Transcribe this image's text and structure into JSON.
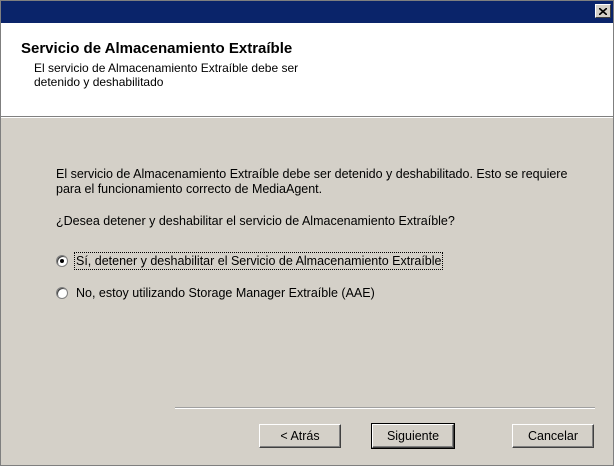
{
  "titlebar": {
    "close_icon": "close-icon"
  },
  "header": {
    "title": "Servicio de Almacenamiento Extraíble",
    "subtitle": "El servicio de Almacenamiento Extraíble debe ser detenido y deshabilitado"
  },
  "body": {
    "description": "El servicio de Almacenamiento Extraíble debe ser detenido y deshabilitado. Esto se requiere para el funcionamiento correcto de MediaAgent.",
    "question": "¿Desea detener y deshabilitar el servicio de Almacenamiento Extraíble?",
    "options": [
      {
        "label": "Sí, detener y deshabilitar el Servicio de Almacenamiento Extraíble",
        "selected": true
      },
      {
        "label": "No, estoy utilizando Storage Manager Extraíble (AAE)",
        "selected": false
      }
    ]
  },
  "buttons": {
    "back_label": "< Atrás",
    "next_label": "Siguiente",
    "cancel_label": "Cancelar"
  },
  "colors": {
    "titlebar": "#0a246a",
    "dialog_bg": "#d4d0c8",
    "header_bg": "#ffffff"
  }
}
